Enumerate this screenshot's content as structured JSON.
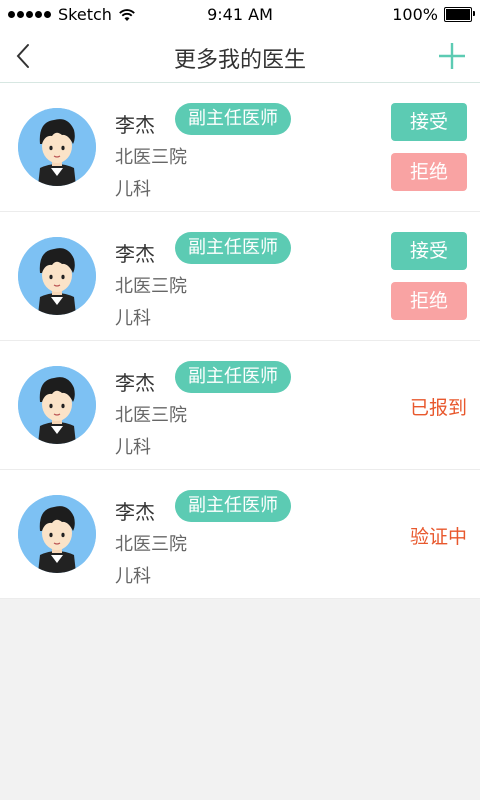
{
  "status_bar": {
    "carrier": "Sketch",
    "time": "9:41 AM",
    "battery": "100%"
  },
  "nav": {
    "title": "更多我的医生",
    "back_icon": "chevron-left-icon",
    "add_icon": "plus-icon"
  },
  "colors": {
    "accent": "#5ccbb3",
    "reject": "#f9a3a3",
    "status_text": "#e8582d",
    "avatar_bg": "#7dc1f3"
  },
  "doctors": [
    {
      "name": "李杰",
      "title": "副主任医师",
      "hospital": "北医三院",
      "department": "儿科",
      "accept_label": "接受",
      "reject_label": "拒绝"
    },
    {
      "name": "李杰",
      "title": "副主任医师",
      "hospital": "北医三院",
      "department": "儿科",
      "accept_label": "接受",
      "reject_label": "拒绝"
    },
    {
      "name": "李杰",
      "title": "副主任医师",
      "hospital": "北医三院",
      "department": "儿科",
      "status": "已报到"
    },
    {
      "name": "李杰",
      "title": "副主任医师",
      "hospital": "北医三院",
      "department": "儿科",
      "status": "验证中"
    }
  ]
}
